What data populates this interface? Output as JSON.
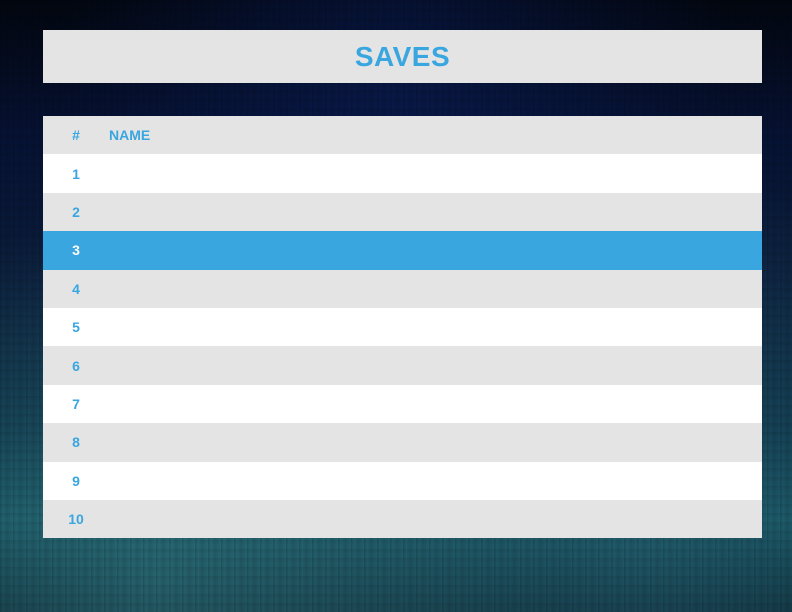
{
  "title": "SAVES",
  "table": {
    "headers": {
      "number": "#",
      "name": "NAME"
    },
    "selected_row": 3,
    "rows": [
      {
        "number": "1",
        "name": ""
      },
      {
        "number": "2",
        "name": ""
      },
      {
        "number": "3",
        "name": ""
      },
      {
        "number": "4",
        "name": ""
      },
      {
        "number": "5",
        "name": ""
      },
      {
        "number": "6",
        "name": ""
      },
      {
        "number": "7",
        "name": ""
      },
      {
        "number": "8",
        "name": ""
      },
      {
        "number": "9",
        "name": ""
      },
      {
        "number": "10",
        "name": ""
      }
    ]
  },
  "colors": {
    "accent": "#39a6e0",
    "panel": "#e4e4e4",
    "row_alt": "#ffffff"
  }
}
